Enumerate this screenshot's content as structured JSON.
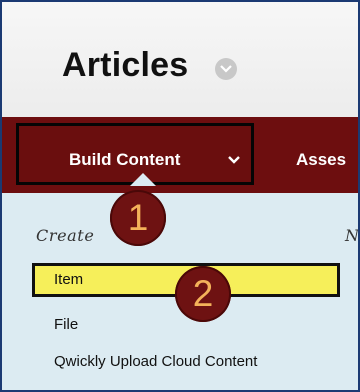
{
  "header": {
    "title": "Articles"
  },
  "toolbar": {
    "build_content": "Build Content",
    "assessments_truncated": "Asses"
  },
  "dropdown": {
    "columns": {
      "create": "Create",
      "new": "N"
    },
    "items": [
      {
        "label": "Item"
      },
      {
        "label": "File"
      },
      {
        "label": "Qwickly Upload Cloud Content"
      }
    ]
  },
  "callouts": {
    "step1": "1",
    "step2": "2"
  },
  "colors": {
    "toolbar": "#6d0e0f",
    "dropdown_bg": "#dcebf2",
    "highlight": "#f6ef5a",
    "badge": "#6e1212",
    "badge_text": "#f4b25a",
    "frame_border": "#1b3a73"
  }
}
